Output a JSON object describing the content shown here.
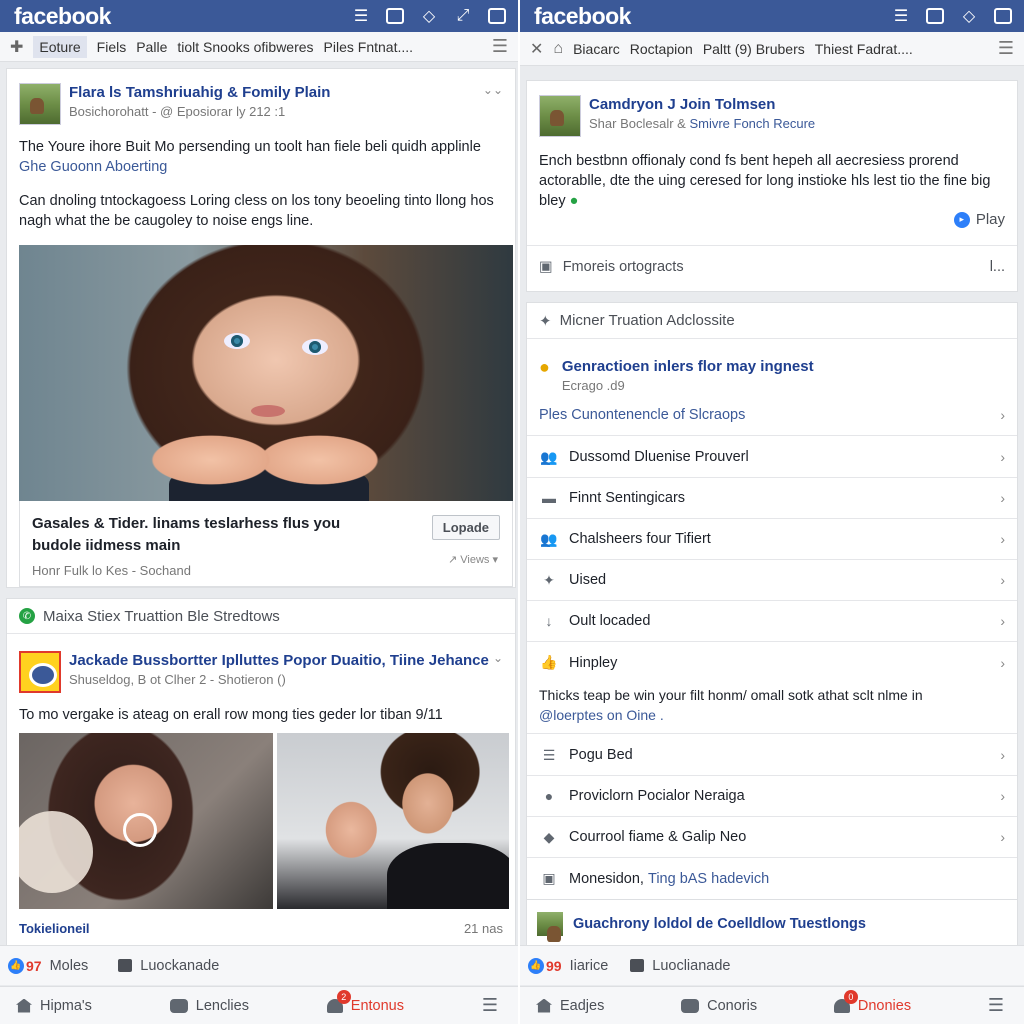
{
  "app": {
    "logo": "facebook"
  },
  "left": {
    "subbar": {
      "items": [
        "Eoture",
        "Fiels",
        "Palle",
        "tiolt Snooks ofibweres",
        "Piles Fntnat...."
      ]
    },
    "post1": {
      "author": "Flara ls Tamshriuahig & Fomily Plain",
      "meta": "Bosichorohatt - @ Eposiorar ly 212 :1",
      "text1": "The Youre ihore Buit Mo persending un toolt han fiele beli quidh applinle",
      "text1_link": "Ghe Guoonn Aboerting",
      "text2": "Can dnoling tntockagoess Loring cless on los tony beoeling tinto llong hos nagh what the be caugoley to noise engs line.",
      "preview_title": "Gasales & Tider. linams teslarhess flus you budole iidmess main",
      "preview_sub": "Honr Fulk lo Kes - Sochand",
      "preview_button": "Lopade",
      "preview_views": "Views"
    },
    "section": {
      "title": "Maixa Stiex Truattion Ble Stredtows"
    },
    "post2": {
      "author": "Jackade Bussbortter Iplluttes Popor Duaitio, Tiine Jehance",
      "meta": "Shuseldog, B ot Clher 2 - Shotieron ()",
      "text": "To mo vergake is ateag on erall row mong ties geder lor tiban 9/11",
      "caption_left": "Tokielioneil",
      "caption_right": "21 nas"
    },
    "bar1": {
      "count": "97",
      "item2": "Moles",
      "item3": "Luockanade"
    },
    "bar2": {
      "item1": "Hipma's",
      "item2": "Lenclies",
      "alert_count": "2",
      "item3": "Entonus"
    }
  },
  "right": {
    "subbar": {
      "items": [
        "Biacarc",
        "Roctapion",
        "Paltt (9) Brubers",
        "Thiest Fadrat...."
      ]
    },
    "post": {
      "author": "Camdryon J Join Tolmsen",
      "meta_a": "Shar Boclesalr &",
      "meta_b": "Smivre Fonch Recure",
      "text": "Ench bestbnn offionaly cond fs bent hepeh all aecresiess prorend actorablle, dte the uing ceresed for long instioke hls lest tio the fine big bley",
      "play": "Play",
      "footer": "Fmoreis ortogracts",
      "footer_more": "l..."
    },
    "section": {
      "title": "Micner Truation Adclossite"
    },
    "feature": {
      "title": "Genractioen inlers flor may ingnest",
      "sub": "Ecrago .d9",
      "link": "Ples Cunontenencle of Slcraops"
    },
    "rows": [
      {
        "label": "Dussomd Dluenise Prouverl",
        "icon": "people-icon"
      },
      {
        "label": "Finnt Sentingicars",
        "icon": "chat-icon"
      },
      {
        "label": "Chalsheers four Tifiert",
        "icon": "people-icon"
      },
      {
        "label": "Uised",
        "icon": "twitter-icon"
      },
      {
        "label": "Oult locaded",
        "icon": "download-icon"
      },
      {
        "label": "Hinpley",
        "icon": "thumb-icon"
      }
    ],
    "note": {
      "text": "Thicks teap be win your filt honm/ omall sotk athat sclt nlme in",
      "link": "@loerptes on Oine ."
    },
    "rows2": [
      {
        "label": "Pogu Bed",
        "icon": "list-icon"
      },
      {
        "label": "Proviclorn Pocialor Neraiga",
        "icon": "person-icon"
      },
      {
        "label": "Courrool fiame & Galip Neo",
        "icon": "diamond-icon"
      }
    ],
    "monesidon": {
      "text": "Monesidon,",
      "link": "Ting bAS hadevich"
    },
    "group_post": {
      "title": "Guachrony loldol de Coelldlow Tuestlongs"
    },
    "bar1": {
      "count": "99",
      "item2": "Iiarice",
      "item3": "Luoclianade"
    },
    "bar2": {
      "item1": "Eadjes",
      "item2": "Conoris",
      "alert_count": "0",
      "item3": "Dnonies"
    }
  },
  "colors": {
    "brand": "#3b5998",
    "alert": "#e0392c",
    "link": "#3b5998"
  }
}
